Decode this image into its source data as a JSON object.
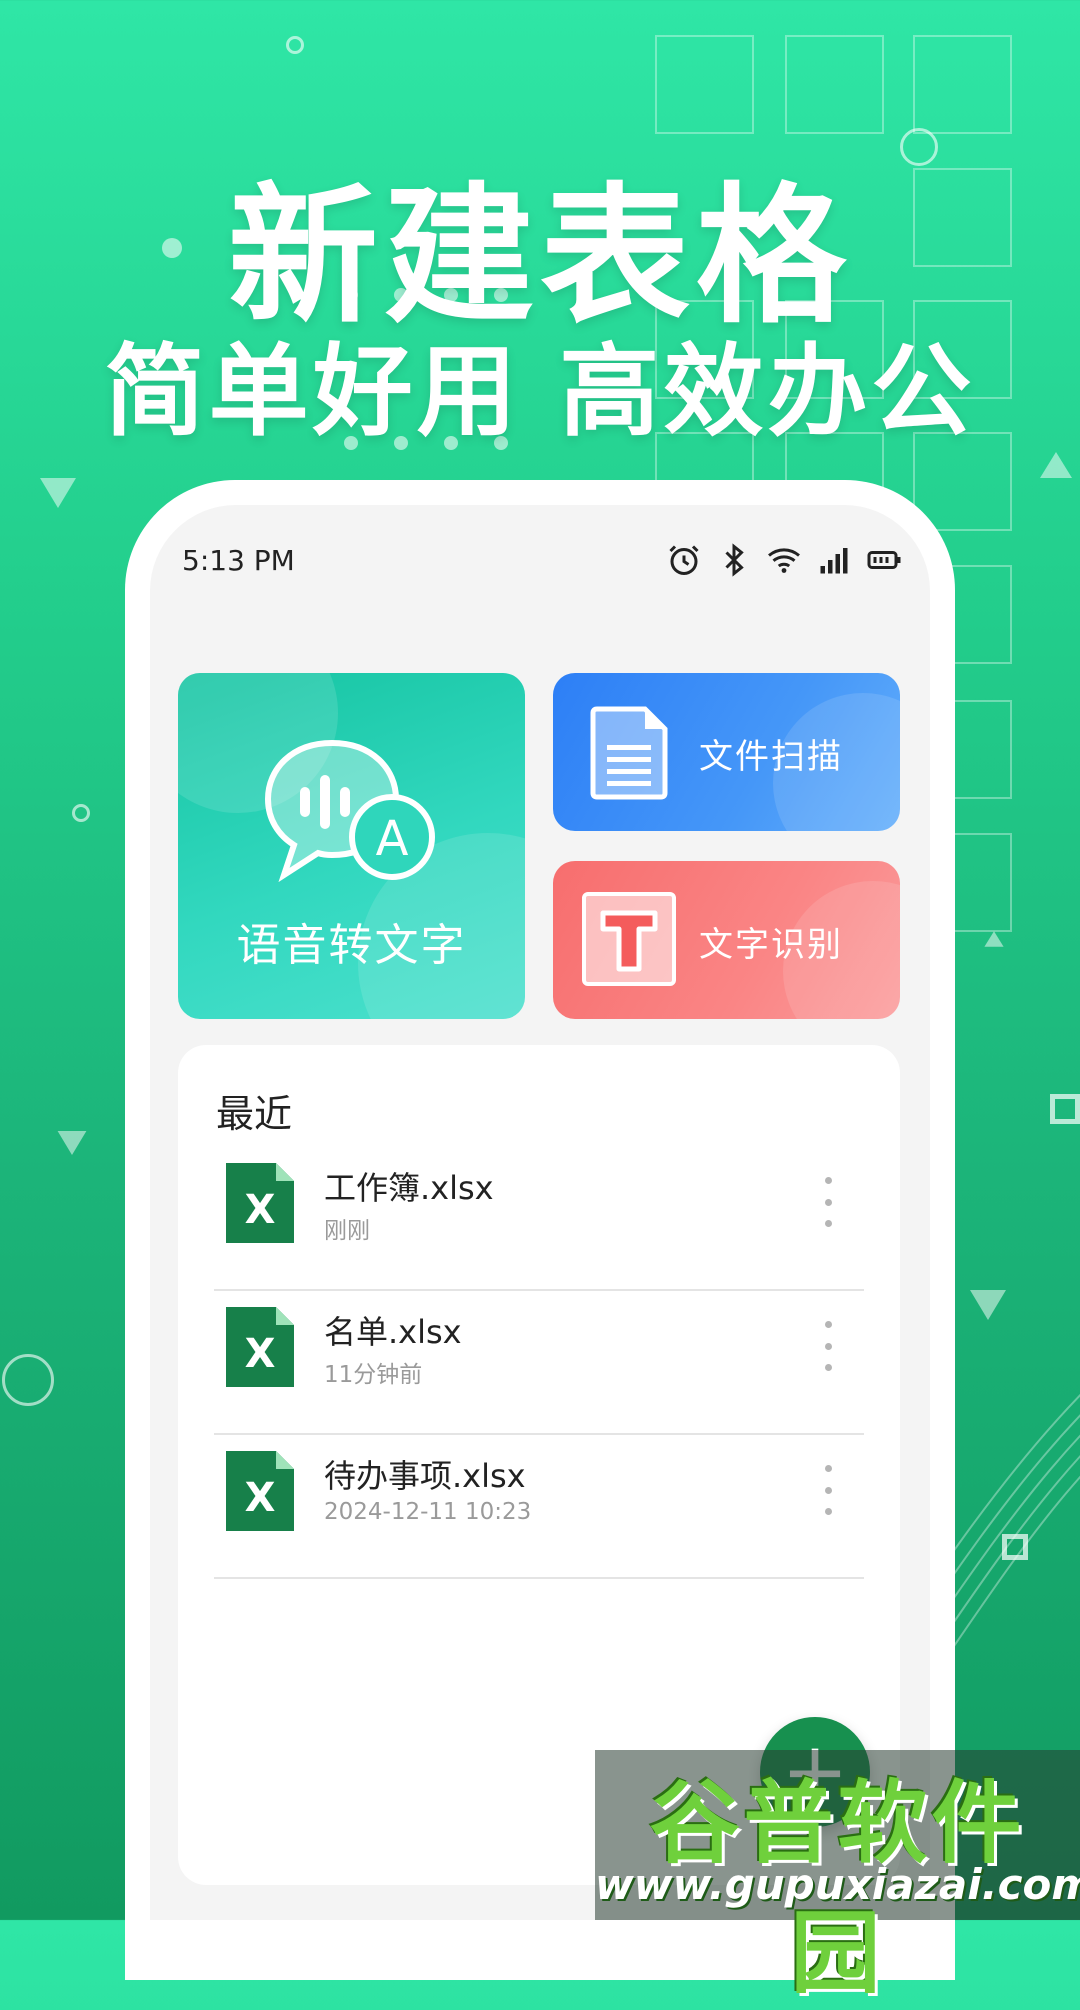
{
  "headline": {
    "title": "新建表格",
    "subtitle": "简单好用 高效办公"
  },
  "status_bar": {
    "time": "5:13 PM",
    "icons": [
      "alarm-icon",
      "bluetooth-icon",
      "wifi-icon",
      "signal-icon",
      "battery-icon"
    ]
  },
  "feature_cards": {
    "voice": {
      "label": "语音转文字",
      "icon": "voice-to-text-icon",
      "color": "#26d0b4"
    },
    "scan": {
      "label": "文件扫描",
      "icon": "document-icon",
      "color": "#3d8ef7"
    },
    "ocr": {
      "label": "文字识别",
      "icon": "text-t-icon",
      "color": "#f87c7c"
    }
  },
  "recent": {
    "title": "最近",
    "files": [
      {
        "name": "工作簿.xlsx",
        "time": "刚刚"
      },
      {
        "name": "名单.xlsx",
        "time": "11分钟前"
      },
      {
        "name": "待办事项.xlsx",
        "time": "2024-12-11  10:23"
      }
    ]
  },
  "fab": {
    "label": "+"
  },
  "watermark": {
    "brand": "谷普软件园",
    "url": "www.gupuxiazai.com"
  },
  "colors": {
    "background_top": "#2fe6a6",
    "background_bottom": "#119a60",
    "excel_green": "#17804a",
    "fab_green": "#17904f"
  }
}
